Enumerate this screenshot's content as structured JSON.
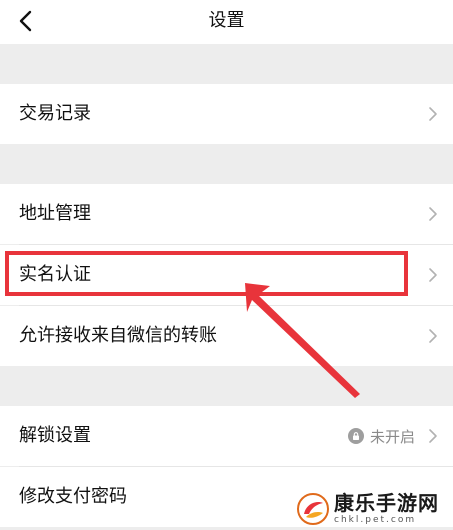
{
  "header": {
    "title": "设置",
    "back_icon": "chevron-left-icon"
  },
  "rows": [
    {
      "label": "交易记录"
    },
    {
      "label": "地址管理"
    },
    {
      "label": "实名认证"
    },
    {
      "label": "允许接收来自微信的转账"
    },
    {
      "label": "解锁设置",
      "status": "未开启",
      "status_icon": "lock-icon"
    },
    {
      "label": "修改支付密码"
    }
  ],
  "annotation": {
    "highlight_color": "#e8343b"
  },
  "watermark": {
    "title": "康乐手游网",
    "url": "chkl.pet.com"
  },
  "colors": {
    "background": "#ededed",
    "row_background": "#ffffff",
    "chevron": "#b2b2b2"
  }
}
